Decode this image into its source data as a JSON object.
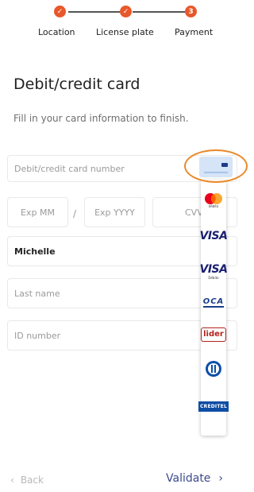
{
  "stepper": {
    "steps": [
      {
        "label": "Location",
        "marker": "✓"
      },
      {
        "label": "License plate",
        "marker": "✓"
      },
      {
        "label": "Payment",
        "marker": "3"
      }
    ]
  },
  "header": {
    "title": "Debit/credit card",
    "subtitle": "Fill in your card information to finish."
  },
  "form": {
    "card_number_placeholder": "Debit/credit card number",
    "exp_mm_placeholder": "Exp MM",
    "slash": "/",
    "exp_yyyy_placeholder": "Exp YYYY",
    "cvv_placeholder": "CVV",
    "first_name_value": "Michelle",
    "last_name_placeholder": "Last name",
    "id_number_placeholder": "ID number"
  },
  "brands": {
    "mastercard_sub": "débito",
    "visa_label": "VISA",
    "visa_debito_label": "VISA",
    "visa_debito_sub": "Débito",
    "oca_label": "OCA",
    "lider_label": "lider",
    "creditel_label": "CREDITEL"
  },
  "footer": {
    "back_label": "Back",
    "back_icon": "‹",
    "validate_label": "Validate",
    "validate_icon": "›"
  },
  "colors": {
    "accent": "#e8582a",
    "primary_action": "#3c4a8c",
    "highlight_ring": "#e88a2c"
  }
}
